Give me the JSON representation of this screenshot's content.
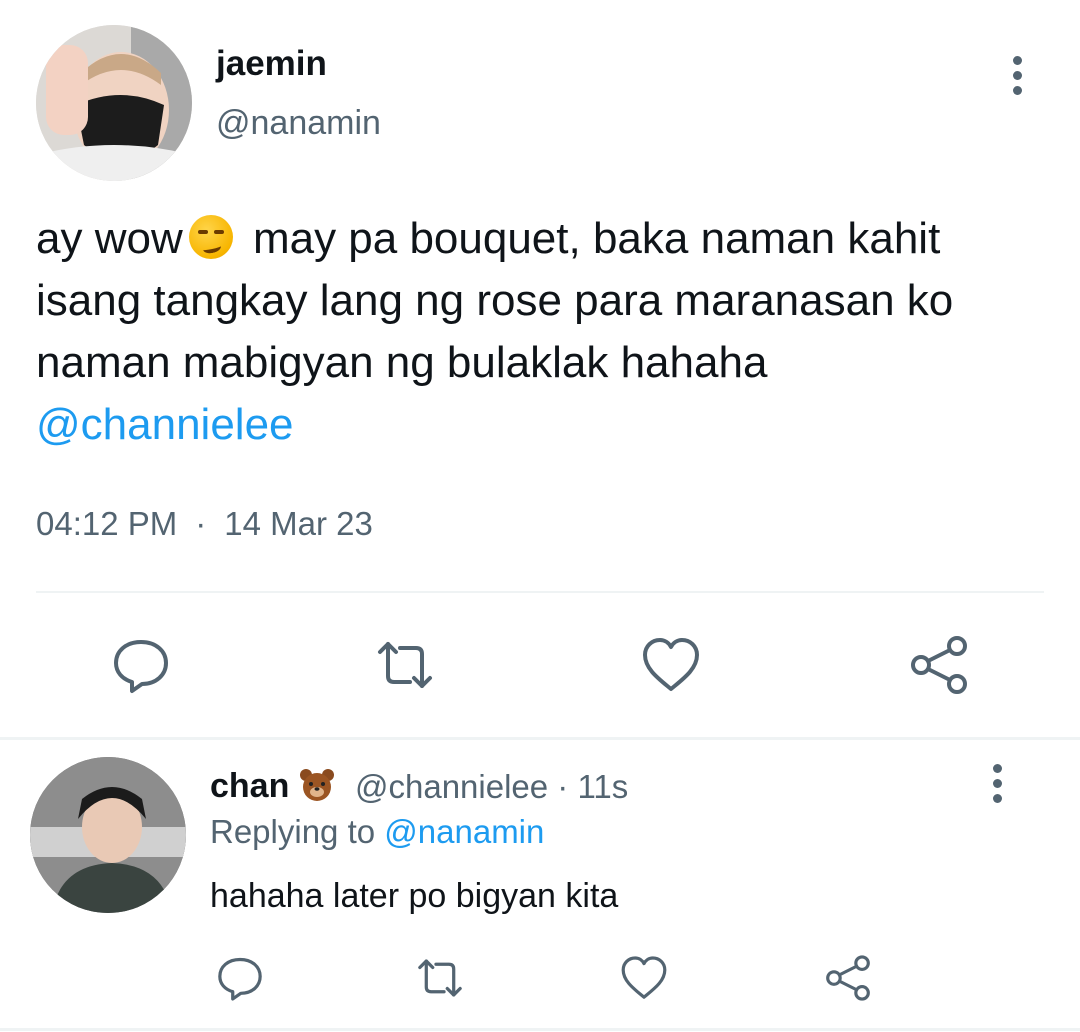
{
  "tweet": {
    "display_name": "jaemin",
    "handle": "@nanamin",
    "text_before_emoji": "ay wow",
    "emoji": "smirking-face",
    "text_after_emoji": " may pa bouquet, baka naman kahit isang tangkay lang ng rose para maranasan ko naman mabigyan ng bulaklak hahaha",
    "mention": "@channielee",
    "time": "04:12 PM",
    "separator": "·",
    "date": "14 Mar 23"
  },
  "reply": {
    "display_name": "chan",
    "emoji": "bear-face",
    "handle_time": "@channielee · 11s",
    "replying_label": "Replying to",
    "replying_handle": "@nanamin",
    "text": "hahaha later po bigyan kita"
  },
  "icons": {
    "actions": [
      "reply-icon",
      "retweet-icon",
      "like-icon",
      "share-icon"
    ],
    "more": "more-vertical-icon"
  },
  "colors": {
    "link": "#1d9bf0",
    "secondary_text": "#536471",
    "divider": "#eff3f4"
  }
}
